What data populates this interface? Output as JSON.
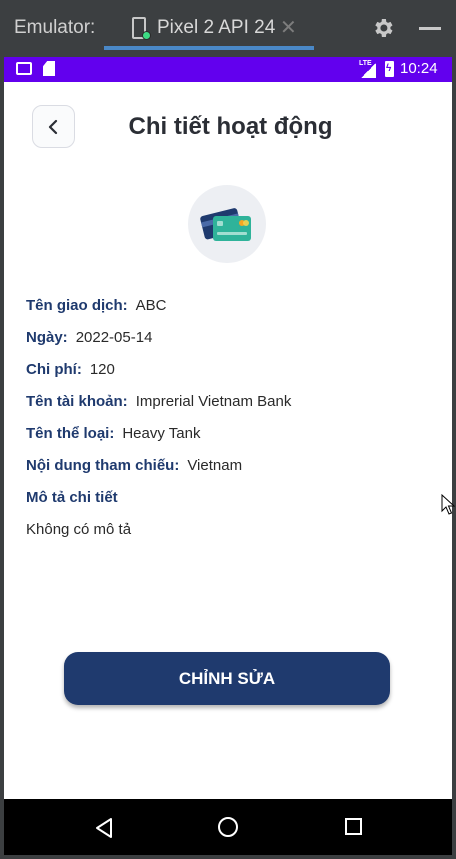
{
  "emulator": {
    "title": "Emulator:",
    "device_tab": "Pixel 2 API 24",
    "close_glyph": "✕",
    "accent_color": "#4a88c7"
  },
  "status_bar": {
    "network": "LTE",
    "time": "10:24",
    "color": "#6200ee"
  },
  "header": {
    "back_icon": "chevron-left-icon",
    "title": "Chi tiết hoạt động"
  },
  "hero_icon": "credit-card-icon",
  "details": [
    {
      "label": "Tên giao dịch:",
      "value": "ABC"
    },
    {
      "label": "Ngày:",
      "value": "2022-05-14"
    },
    {
      "label": "Chi phí:",
      "value": "120"
    },
    {
      "label": "Tên tài khoản:",
      "value": "Imprerial Vietnam Bank"
    },
    {
      "label": "Tên thể loại:",
      "value": "Heavy Tank"
    },
    {
      "label": "Nội dung tham chiếu:",
      "value": "Vietnam"
    }
  ],
  "description": {
    "label": "Mô tả chi tiết",
    "value": "Không có mô tả"
  },
  "edit_button": {
    "label": "CHỈNH SỬA",
    "color": "#1f3a6e"
  },
  "nav_bar": {
    "icons": [
      "back-triangle-icon",
      "home-circle-icon",
      "recents-square-icon"
    ]
  }
}
